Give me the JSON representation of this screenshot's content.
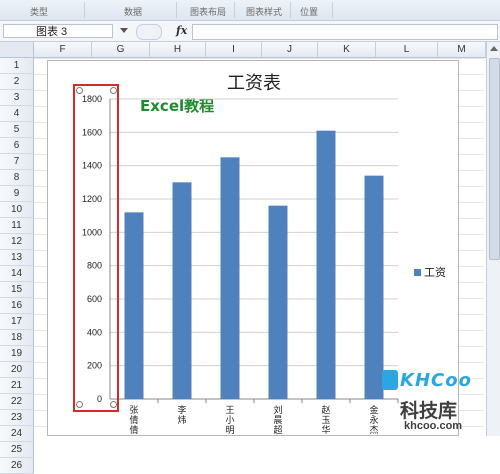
{
  "ribbon": {
    "groups": [
      "类型",
      "数据",
      "图表布局",
      "图表样式",
      "位置"
    ]
  },
  "formula_bar": {
    "name_box": "图表 3",
    "fx_label": "fx",
    "value": ""
  },
  "columns": [
    "F",
    "G",
    "H",
    "I",
    "J",
    "K",
    "L",
    "M"
  ],
  "rows": [
    "1",
    "2",
    "3",
    "4",
    "5",
    "6",
    "7",
    "8",
    "9",
    "10",
    "11",
    "12",
    "13",
    "14",
    "15",
    "16",
    "17",
    "18",
    "19",
    "20",
    "21",
    "22",
    "23",
    "24",
    "25",
    "26"
  ],
  "chart": {
    "title": "工资表",
    "subtitle_overlay": "Excel教程",
    "legend_label": "工资"
  },
  "chart_data": {
    "type": "bar",
    "categories": [
      "张倩倩",
      "李炜",
      "王小明",
      "刘晨超",
      "赵玉华",
      "金永杰"
    ],
    "series": [
      {
        "name": "工资",
        "values": [
          1120,
          1300,
          1450,
          1160,
          1610,
          1340
        ]
      }
    ],
    "ylim": [
      0,
      1800
    ],
    "yticks": [
      0,
      200,
      400,
      600,
      800,
      1000,
      1200,
      1400,
      1600,
      1800
    ],
    "grid": true,
    "legend_position": "right",
    "bar_color": "#4f81bd"
  },
  "watermark": {
    "brand_top": "KHCoo",
    "brand_main": "科技库",
    "url": "khcoo.com"
  },
  "colors": {
    "selection_outline": "#d42a2a",
    "bar": "#4f81bd",
    "gridline": "#d0d0d0"
  }
}
